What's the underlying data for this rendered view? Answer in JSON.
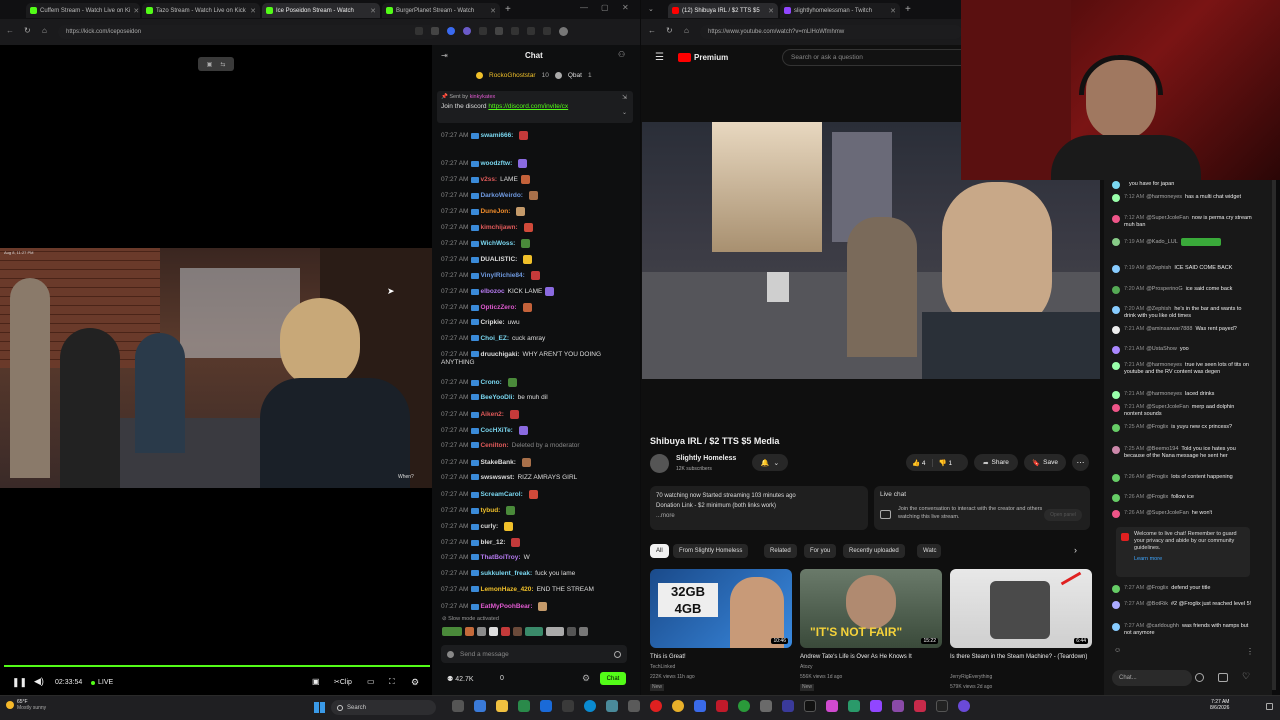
{
  "left_browser": {
    "tabs": [
      {
        "label": "Cuffem Stream - Watch Live on Ki",
        "color": "#53fc18"
      },
      {
        "label": "Tazo Stream - Watch Live on Kick",
        "color": "#53fc18"
      },
      {
        "label": "Ice Poseidon Stream - Watch",
        "color": "#53fc18"
      },
      {
        "label": "BurgerPlanet Stream - Watch",
        "color": "#53fc18"
      }
    ],
    "url": "https://kick.com/iceposeidon"
  },
  "player": {
    "overlay_date": "Aug 8, 11:27 PM",
    "time": "02:33:54",
    "live_label": "LIVE",
    "clip_label": "Clip",
    "overlay_text": "When?"
  },
  "kick_chat": {
    "title": "Chat",
    "pinned_users": [
      {
        "name": "RockoGhoststar",
        "count": "10"
      },
      {
        "name": "Qbat",
        "count": "1"
      }
    ],
    "pinned_sent_by": "Sent by",
    "pinned_sender": "kinkykatex",
    "pinned_text": "Join the discord",
    "pinned_link": "https://discord.com/invite/cx",
    "messages": [
      {
        "time": "07:27 AM",
        "user": "swami666:",
        "text": "",
        "color": "#7ad7f0"
      },
      {
        "time": "07:27 AM",
        "user": "woodzftw:",
        "text": "",
        "color": "#7ad7f0"
      },
      {
        "time": "07:27 AM",
        "user": "v2ss:",
        "text": "LAME",
        "color": "#e05a5a"
      },
      {
        "time": "07:27 AM",
        "user": "DarkoWeirdo:",
        "text": "",
        "color": "#6f9ae0"
      },
      {
        "time": "07:27 AM",
        "user": "DuneJon:",
        "text": "",
        "color": "#f08c2a"
      },
      {
        "time": "07:27 AM",
        "user": "kimchijawn:",
        "text": "",
        "color": "#e05a5a"
      },
      {
        "time": "07:27 AM",
        "user": "WichWoss:",
        "text": "",
        "color": "#7ad7f0"
      },
      {
        "time": "07:27 AM",
        "user": "DUALISTIC:",
        "text": "",
        "color": "#dddddd"
      },
      {
        "time": "07:27 AM",
        "user": "VinylRichie84:",
        "text": "",
        "color": "#6f9ae0"
      },
      {
        "time": "07:27 AM",
        "user": "elbozoc",
        "text": "KICK LAME",
        "color": "#b57af0"
      },
      {
        "time": "07:27 AM",
        "user": "OpticzZero:",
        "text": "",
        "color": "#e05ad0"
      },
      {
        "time": "07:27 AM",
        "user": "Cripkie:",
        "text": "uwu",
        "color": "#dddddd"
      },
      {
        "time": "07:27 AM",
        "user": "Choi_EZ:",
        "text": "cuck amray",
        "color": "#7ad7f0"
      },
      {
        "time": "07:27 AM",
        "user": "druuchigaki:",
        "text": "WHY AREN'T YOU DOING ANYTHING",
        "color": "#dddddd"
      },
      {
        "time": "07:27 AM",
        "user": "Crono:",
        "text": "",
        "color": "#7ad7f0"
      },
      {
        "time": "07:27 AM",
        "user": "BeeYooDli:",
        "text": "be muh dil",
        "color": "#7ad7f0"
      },
      {
        "time": "07:27 AM",
        "user": "Aiken2:",
        "text": "",
        "color": "#e05a5a"
      },
      {
        "time": "07:27 AM",
        "user": "CocHXiTe:",
        "text": "",
        "color": "#7ad7f0"
      },
      {
        "time": "07:27 AM",
        "user": "Cenilton:",
        "text": "Deleted by a moderator",
        "color": "#e05a5a"
      },
      {
        "time": "07:27 AM",
        "user": "StakeBank:",
        "text": "",
        "color": "#dddddd"
      },
      {
        "time": "07:27 AM",
        "user": "swswswst:",
        "text": "RIZZ AMRAYS GIRL",
        "color": "#dddddd"
      },
      {
        "time": "07:27 AM",
        "user": "ScreamCarol:",
        "text": "",
        "color": "#7ad7f0"
      },
      {
        "time": "07:27 AM",
        "user": "tybud:",
        "text": "",
        "color": "#f0c02a"
      },
      {
        "time": "07:27 AM",
        "user": "curly:",
        "text": "",
        "color": "#dddddd"
      },
      {
        "time": "07:27 AM",
        "user": "bler_12:",
        "text": "",
        "color": "#dddddd"
      },
      {
        "time": "07:27 AM",
        "user": "ThatBoiTroy:",
        "text": "W",
        "color": "#b57af0"
      },
      {
        "time": "07:27 AM",
        "user": "sukkulent_freak:",
        "text": "fuck you lame",
        "color": "#7ad7f0"
      },
      {
        "time": "07:27 AM",
        "user": "LemonHaze_420:",
        "text": "END THE STREAM",
        "color": "#f0c02a"
      },
      {
        "time": "07:27 AM",
        "user": "EatMyPoohBear:",
        "text": "",
        "color": "#e05ad0"
      }
    ],
    "slow_mode": "Slow mode activated",
    "input_placeholder": "Send a message",
    "viewers": "42.7K",
    "zero": "0",
    "send_label": "Chat"
  },
  "right_browser": {
    "tabs": [
      {
        "label": "(12) Shibuya IRL / $2 TTS $5",
        "color": "#ff0000"
      },
      {
        "label": "slightlyhomelessman - Twitch",
        "color": "#9146ff"
      }
    ],
    "url": "https://www.youtube.com/watch?v=mLlHoWfmhmw"
  },
  "youtube": {
    "brand": "Premium",
    "search_placeholder": "Search or ask a question",
    "video_title": "Shibuya IRL / $2 TTS $5 Media",
    "channel": "Slightly Homeless",
    "subs": "12K subscribers",
    "likes": "4",
    "dislikes": "1",
    "share": "Share",
    "save": "Save",
    "desc_line1": "70 watching now  Started streaming 103 minutes ago",
    "desc_line2": "Donation Link - $2 minimum (both links work)",
    "desc_more": "...more",
    "live_chat_title": "Live chat",
    "live_chat_text": "Join the conversation to interact with the creator and others watching this live stream.",
    "open_panel": "Open panel",
    "chips": [
      "All",
      "From Slightly Homeless",
      "Related",
      "For you",
      "Recently uploaded",
      "Watc"
    ],
    "videos": [
      {
        "title": "This is Great!",
        "channel": "TechLinked",
        "meta": "222K views  11h ago",
        "badge": "New",
        "duration": "10:46",
        "thumb_text": "32GB 4GB"
      },
      {
        "title": "Andrew Tate's Life is Over As He Knows It",
        "channel": "Atozy",
        "meta": "556K views  1d ago",
        "badge": "New",
        "duration": "15:22",
        "thumb_text": "\"IT'S NOT FAIR\""
      },
      {
        "title": "Is there Steam in the Steam Machine? - (Teardown)",
        "channel": "JerryRigEverything",
        "meta": "579K views  2d ago",
        "badge": "",
        "duration": "6:44",
        "thumb_text": ""
      }
    ],
    "chat_messages": [
      {
        "time": "",
        "user": "",
        "text": "you have for japan",
        "color": "#7ad7f0"
      },
      {
        "time": "7:12 AM",
        "user": "@harmoneyes",
        "text": "has a multi chat widget",
        "color": "#9fa"
      },
      {
        "time": "7:12 AM",
        "user": "@SuperJcoleFan",
        "text": "now is perma cry stream muh ban",
        "color": "#e58"
      },
      {
        "time": "7:19 AM",
        "user": "@Kado_LUL",
        "text": "",
        "color": "#8c8"
      },
      {
        "time": "7:19 AM",
        "user": "@Zephish",
        "text": "ICE SAID COME BACK",
        "color": "#8cf"
      },
      {
        "time": "7:20 AM",
        "user": "@ProsperinoG",
        "text": "ice said come back",
        "color": "#5a5"
      },
      {
        "time": "7:20 AM",
        "user": "@Zephish",
        "text": "he's in the bar and wants to drink with you like old times",
        "color": "#8cf"
      },
      {
        "time": "7:21 AM",
        "user": "@aminsarwar7888",
        "text": "Was rent payed?",
        "color": "#eee"
      },
      {
        "time": "7:21 AM",
        "user": "@UstaShow",
        "text": "yoo",
        "color": "#a8f"
      },
      {
        "time": "7:21 AM",
        "user": "@harmoneyes",
        "text": "true ive seen lots of tits on youtube and the RV content was degen",
        "color": "#9fa"
      },
      {
        "time": "7:21 AM",
        "user": "@harmoneyes",
        "text": "laced drinks",
        "color": "#9fa"
      },
      {
        "time": "7:21 AM",
        "user": "@SuperJcoleFan",
        "text": "merp aad dolphin nontent sounds",
        "color": "#e58"
      },
      {
        "time": "7:25 AM",
        "user": "@Froglix",
        "text": "is yuyu new cx princess?",
        "color": "#6c6"
      },
      {
        "time": "7:25 AM",
        "user": "@Beemo194",
        "text": "Told you ice hates you because of the Nana message he sent her",
        "color": "#c8a"
      },
      {
        "time": "7:26 AM",
        "user": "@Froglix",
        "text": "lots of content happening",
        "color": "#6c6"
      },
      {
        "time": "7:26 AM",
        "user": "@Froglix",
        "text": "follow ice",
        "color": "#6c6"
      },
      {
        "time": "7:26 AM",
        "user": "@SuperJcoleFan",
        "text": "he won't",
        "color": "#e58"
      }
    ],
    "welcome_text": "Welcome to live chat! Remember to guard your privacy and abide by our community guidelines.",
    "learn_more": "Learn more",
    "chat_messages2": [
      {
        "time": "7:27 AM",
        "user": "@Froglix",
        "text": "defend your title",
        "color": "#6c6"
      },
      {
        "time": "7:27 AM",
        "user": "@BotRik",
        "text": "#2 @Froglix just reached level 5!",
        "color": "#aaf"
      },
      {
        "time": "7:27 AM",
        "user": "@carldoughh",
        "text": "was friends with namps but not anymore",
        "color": "#8cf"
      }
    ],
    "chat_input": "Chat..."
  },
  "taskbar": {
    "weather_temp": "65°F",
    "weather_text": "Mostly sunny",
    "search": "Search",
    "clock_time": "7:27 AM",
    "clock_date": "8/6/2026"
  }
}
